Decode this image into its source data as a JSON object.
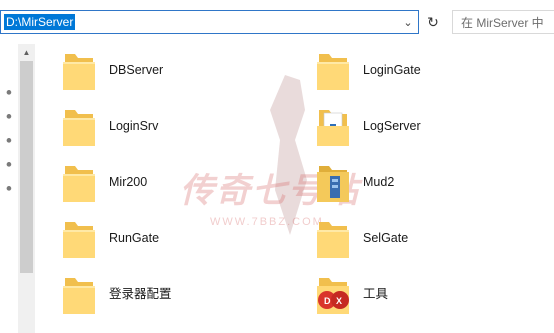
{
  "address_bar": {
    "path": "D:\\MirServer"
  },
  "search": {
    "placeholder": "在 MirServer 中"
  },
  "files": [
    {
      "name": "DBServer",
      "icon": "folder-icon"
    },
    {
      "name": "LoginGate",
      "icon": "folder-icon"
    },
    {
      "name": "LoginSrv",
      "icon": "folder-icon"
    },
    {
      "name": "LogServer",
      "icon": "folder-document-icon"
    },
    {
      "name": "Mir200",
      "icon": "folder-icon"
    },
    {
      "name": "Mud2",
      "icon": "folder-database-icon"
    },
    {
      "name": "RunGate",
      "icon": "folder-icon"
    },
    {
      "name": "SelGate",
      "icon": "folder-icon"
    },
    {
      "name": "登录器配置",
      "icon": "folder-icon"
    },
    {
      "name": "工具",
      "icon": "folder-red-badge-icon"
    }
  ],
  "watermark": {
    "title": "传奇七号站",
    "url": "WWW.7BBZ.COM"
  },
  "colors": {
    "accent": "#0078d7",
    "folder_front": "#ffd977",
    "folder_back": "#f1bf4d"
  }
}
